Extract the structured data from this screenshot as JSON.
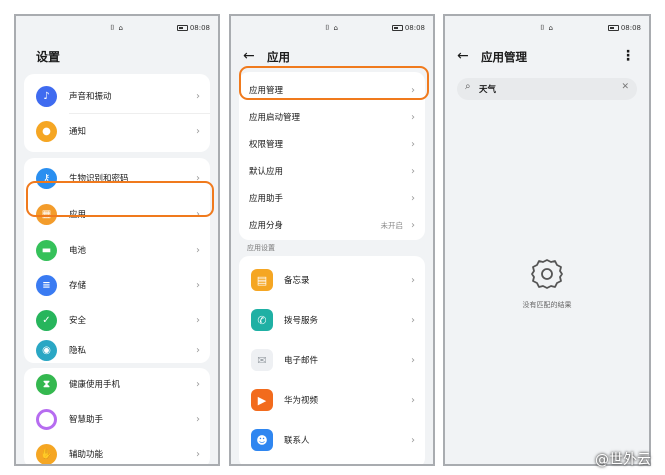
{
  "status_bar": {
    "signal": "⌷ ⌂",
    "time": "08:08"
  },
  "screen1": {
    "title": "设置",
    "items": [
      {
        "label": "声音和振动",
        "icon": "sound-icon",
        "color": "#3f6bf0"
      },
      {
        "label": "通知",
        "icon": "bell-icon",
        "color": "#f5a623"
      },
      {
        "label": "生物识别和密码",
        "icon": "key-icon",
        "color": "#2a8ff0"
      },
      {
        "label": "应用",
        "icon": "apps-grid-icon",
        "color": "#f39c2b"
      },
      {
        "label": "电池",
        "icon": "battery-icon",
        "color": "#35c15a"
      },
      {
        "label": "存储",
        "icon": "storage-icon",
        "color": "#3a7bf2"
      },
      {
        "label": "安全",
        "icon": "shield-icon",
        "color": "#27b55c"
      },
      {
        "label": "隐私",
        "icon": "privacy-icon",
        "color": "#2aa7c4"
      },
      {
        "label": "健康使用手机",
        "icon": "hourglass-icon",
        "color": "#34b84f"
      },
      {
        "label": "智慧助手",
        "icon": "assistant-icon",
        "color": "#b66cf0"
      },
      {
        "label": "辅助功能",
        "icon": "hand-icon",
        "color": "#f5a623"
      }
    ]
  },
  "screen2": {
    "title": "应用",
    "items": [
      "应用管理",
      "应用启动管理",
      "权限管理",
      "默认应用",
      "应用助手",
      "应用分身"
    ],
    "clone_status": "未开启",
    "section_label": "应用设置",
    "apps": [
      {
        "label": "备忘录",
        "icon": "memo-icon",
        "color": "#f5a623"
      },
      {
        "label": "拨号服务",
        "icon": "phone-icon",
        "color": "#1fb0a4"
      },
      {
        "label": "电子邮件",
        "icon": "mail-icon",
        "color": "#c9ccd1"
      },
      {
        "label": "华为视频",
        "icon": "video-icon",
        "color": "#f26b1d"
      },
      {
        "label": "联系人",
        "icon": "contacts-icon",
        "color": "#2f86f0"
      }
    ]
  },
  "screen3": {
    "title": "应用管理",
    "search_value": "天气",
    "empty_text": "没有匹配的结果"
  },
  "watermark": "@世外云"
}
